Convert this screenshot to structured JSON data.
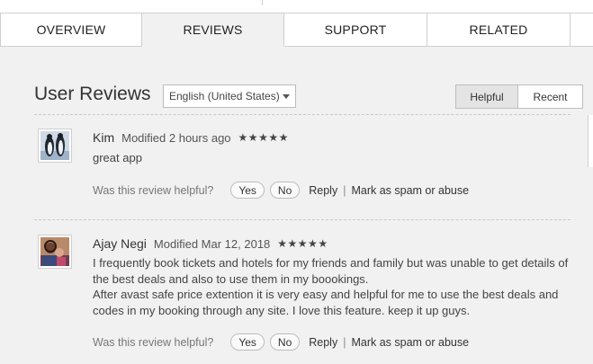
{
  "tabs": [
    {
      "label": "OVERVIEW"
    },
    {
      "label": "REVIEWS"
    },
    {
      "label": "SUPPORT"
    },
    {
      "label": "RELATED"
    }
  ],
  "header": {
    "title": "User Reviews",
    "language": "English (United States)",
    "sort": {
      "helpful": "Helpful",
      "recent": "Recent"
    }
  },
  "reviews": [
    {
      "name": "Kim",
      "modified": "Modified 2 hours ago",
      "stars": "★★★★★",
      "body": [
        "great app"
      ],
      "helpful_prompt": "Was this review helpful?",
      "yes": "Yes",
      "no": "No",
      "reply": "Reply",
      "separator": "|",
      "spam": "Mark as spam or abuse"
    },
    {
      "name": "Ajay Negi",
      "modified": "Modified Mar 12, 2018",
      "stars": "★★★★★",
      "body": [
        "I frequently book tickets and hotels for my friends and family but was unable to get details of the best deals and also to use them in my boookings.",
        "After avast safe price extention it is very easy and helpful for me to use the best deals and codes in my booking through any site. I love this feature. keep it up guys."
      ],
      "helpful_prompt": "Was this review helpful?",
      "yes": "Yes",
      "no": "No",
      "reply": "Reply",
      "separator": "|",
      "spam": "Mark as spam or abuse"
    }
  ]
}
